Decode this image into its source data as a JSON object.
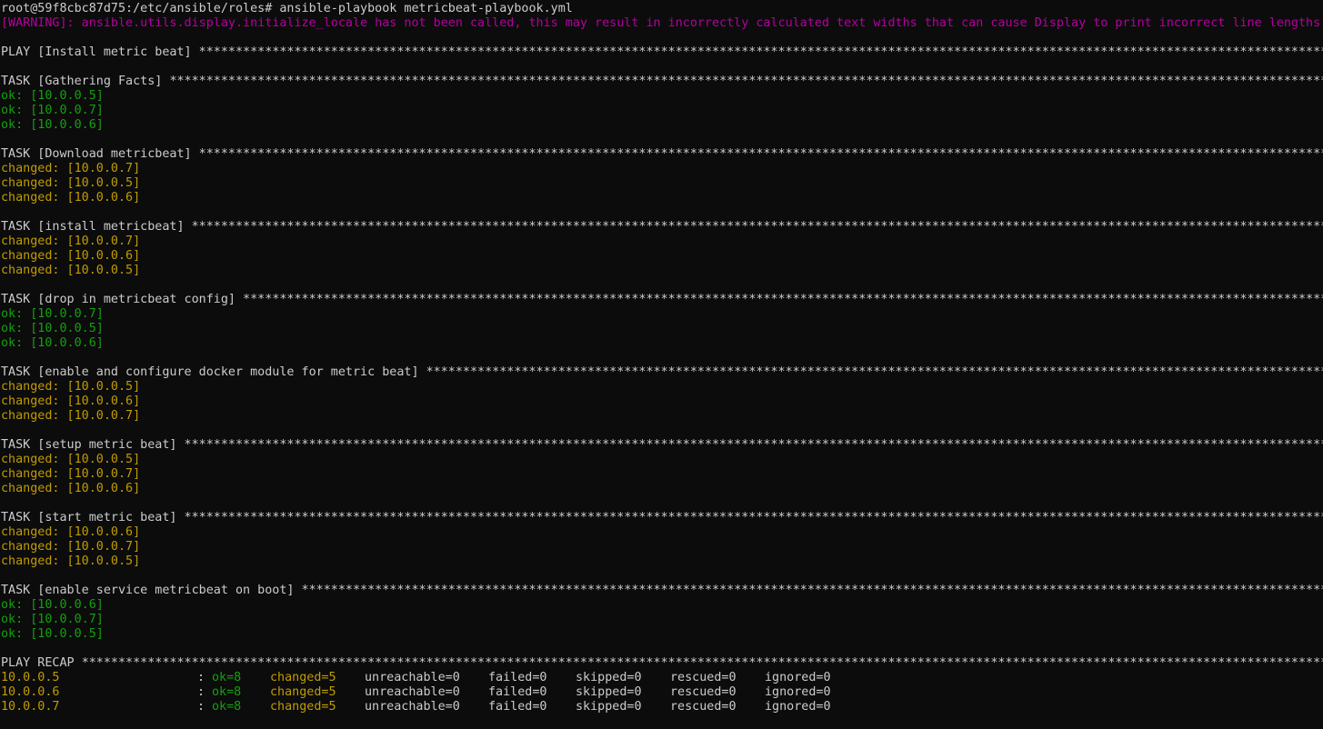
{
  "prompt": {
    "text": "root@59f8cbc87d75:/etc/ansible/roles# ansible-playbook metricbeat-playbook.yml"
  },
  "warning": {
    "text": "[WARNING]: ansible.utils.display.initialize_locale has not been called, this may result in incorrectly calculated text widths that can cause Display to print incorrect line lengths"
  },
  "play": {
    "header": "PLAY [Install metric beat] "
  },
  "tasks": [
    {
      "header": "TASK [Gathering Facts] ",
      "results": [
        {
          "status": "ok",
          "text": "ok: [10.0.0.5]"
        },
        {
          "status": "ok",
          "text": "ok: [10.0.0.7]"
        },
        {
          "status": "ok",
          "text": "ok: [10.0.0.6]"
        }
      ]
    },
    {
      "header": "TASK [Download metricbeat] ",
      "results": [
        {
          "status": "changed",
          "text": "changed: [10.0.0.7]"
        },
        {
          "status": "changed",
          "text": "changed: [10.0.0.5]"
        },
        {
          "status": "changed",
          "text": "changed: [10.0.0.6]"
        }
      ]
    },
    {
      "header": "TASK [install metricbeat] ",
      "results": [
        {
          "status": "changed",
          "text": "changed: [10.0.0.7]"
        },
        {
          "status": "changed",
          "text": "changed: [10.0.0.6]"
        },
        {
          "status": "changed",
          "text": "changed: [10.0.0.5]"
        }
      ]
    },
    {
      "header": "TASK [drop in metricbeat config] ",
      "results": [
        {
          "status": "ok",
          "text": "ok: [10.0.0.7]"
        },
        {
          "status": "ok",
          "text": "ok: [10.0.0.5]"
        },
        {
          "status": "ok",
          "text": "ok: [10.0.0.6]"
        }
      ]
    },
    {
      "header": "TASK [enable and configure docker module for metric beat] ",
      "results": [
        {
          "status": "changed",
          "text": "changed: [10.0.0.5]"
        },
        {
          "status": "changed",
          "text": "changed: [10.0.0.6]"
        },
        {
          "status": "changed",
          "text": "changed: [10.0.0.7]"
        }
      ]
    },
    {
      "header": "TASK [setup metric beat] ",
      "results": [
        {
          "status": "changed",
          "text": "changed: [10.0.0.5]"
        },
        {
          "status": "changed",
          "text": "changed: [10.0.0.7]"
        },
        {
          "status": "changed",
          "text": "changed: [10.0.0.6]"
        }
      ]
    },
    {
      "header": "TASK [start metric beat] ",
      "results": [
        {
          "status": "changed",
          "text": "changed: [10.0.0.6]"
        },
        {
          "status": "changed",
          "text": "changed: [10.0.0.7]"
        },
        {
          "status": "changed",
          "text": "changed: [10.0.0.5]"
        }
      ]
    },
    {
      "header": "TASK [enable service metricbeat on boot] ",
      "results": [
        {
          "status": "ok",
          "text": "ok: [10.0.0.6]"
        },
        {
          "status": "ok",
          "text": "ok: [10.0.0.7]"
        },
        {
          "status": "ok",
          "text": "ok: [10.0.0.5]"
        }
      ]
    }
  ],
  "recap": {
    "header": "PLAY RECAP ",
    "separator": ":",
    "rows": [
      {
        "host": "10.0.0.5",
        "ok": "ok=8",
        "changed": "changed=5",
        "unreachable": "unreachable=0",
        "failed": "failed=0",
        "skipped": "skipped=0",
        "rescued": "rescued=0",
        "ignored": "ignored=0"
      },
      {
        "host": "10.0.0.6",
        "ok": "ok=8",
        "changed": "changed=5",
        "unreachable": "unreachable=0",
        "failed": "failed=0",
        "skipped": "skipped=0",
        "rescued": "rescued=0",
        "ignored": "ignored=0"
      },
      {
        "host": "10.0.0.7",
        "ok": "ok=8",
        "changed": "changed=5",
        "unreachable": "unreachable=0",
        "failed": "failed=0",
        "skipped": "skipped=0",
        "rescued": "rescued=0",
        "ignored": "ignored=0"
      }
    ]
  },
  "colors": {
    "background": "#0c0c0c",
    "default": "#cccccc",
    "warning": "#b4009e",
    "ok": "#13a10e",
    "changed": "#c19c00"
  }
}
